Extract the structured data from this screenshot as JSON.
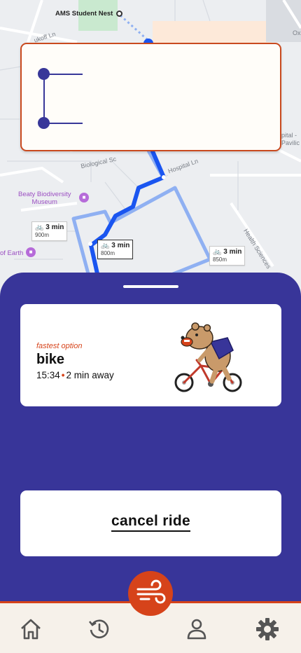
{
  "map": {
    "destination_label": "AMS Student Nest",
    "poi_museum_name": "Beaty Biodiversity\nMuseum",
    "poi_earth_name": "of Earth",
    "street_labels": [
      "Hospital Ln",
      "Biological Sc",
      "Health Sciences",
      "pital -\nPavilic",
      "Ox",
      "ukoff Ln"
    ],
    "route_chips": [
      {
        "time": "3 min",
        "distance": "900m"
      },
      {
        "time": "3 min",
        "distance": "800m"
      },
      {
        "time": "3 min",
        "distance": "850m"
      }
    ]
  },
  "route_card": {
    "from": "",
    "to": ""
  },
  "option": {
    "tag": "fastest option",
    "mode": "bike",
    "eta_time": "15:34",
    "eta_separator": "•",
    "eta_away": "2 min away"
  },
  "cancel": {
    "label": "cancel ride"
  },
  "colors": {
    "primary": "#383599",
    "accent": "#d6431a",
    "route_active": "#1a55f0",
    "route_alt": "#8fb0f2"
  },
  "tabs": [
    {
      "name": "home",
      "icon": "home-icon"
    },
    {
      "name": "history",
      "icon": "history-icon"
    },
    {
      "name": "ride",
      "icon": "wind-icon"
    },
    {
      "name": "profile",
      "icon": "person-icon"
    },
    {
      "name": "settings",
      "icon": "gear-icon"
    }
  ]
}
